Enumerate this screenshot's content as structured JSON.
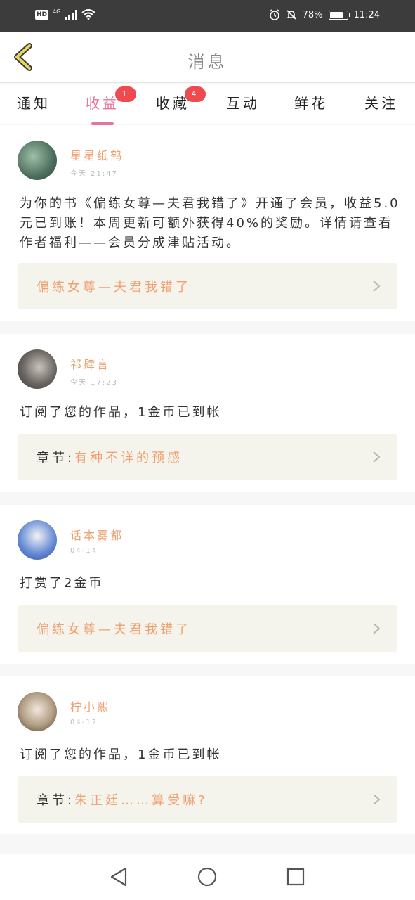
{
  "status_bar": {
    "hd": "HD",
    "network": "4G",
    "battery_text": "78%",
    "battery_level": 0.78,
    "time": "11:24"
  },
  "header": {
    "title": "消息"
  },
  "tabs": [
    {
      "label": "通知",
      "badge": ""
    },
    {
      "label": "收益",
      "badge": "1",
      "active": true
    },
    {
      "label": "收藏",
      "badge": "4"
    },
    {
      "label": "互动",
      "badge": ""
    },
    {
      "label": "鲜花",
      "badge": ""
    },
    {
      "label": "关注",
      "badge": ""
    }
  ],
  "messages": [
    {
      "name": "星星纸鹤",
      "time": "今天 21:47",
      "text": "为你的书《偏练女尊—夫君我错了》开通了会员，收益5.0元已到账！本周更新可额外获得40%的奖励。详情请查看作者福利——会员分成津贴活动。",
      "link_prefix": "",
      "link": "偏练女尊—夫君我错了"
    },
    {
      "name": "祁肆言",
      "time": "今天 17:23",
      "text": "订阅了您的作品，1金币已到帐",
      "link_prefix": "章节:",
      "link": "有种不详的预感"
    },
    {
      "name": "话本雾都",
      "time": "04-14",
      "text": "打赏了2金币",
      "link_prefix": "",
      "link": "偏练女尊—夫君我错了"
    },
    {
      "name": "柠小熙",
      "time": "04-12",
      "text": "订阅了您的作品，1金币已到帐",
      "link_prefix": "章节:",
      "link": "朱正廷……算受嘛?"
    }
  ],
  "icons": {
    "back": "chevron-left-icon",
    "chevron": "chevron-right-icon",
    "nav": [
      "back-triangle-icon",
      "home-circle-icon",
      "recents-square-icon"
    ]
  },
  "colors": {
    "accent": "#e8739b",
    "name": "#f0a070",
    "badge": "#f04a51",
    "back_arrow": "#e6d75a"
  }
}
